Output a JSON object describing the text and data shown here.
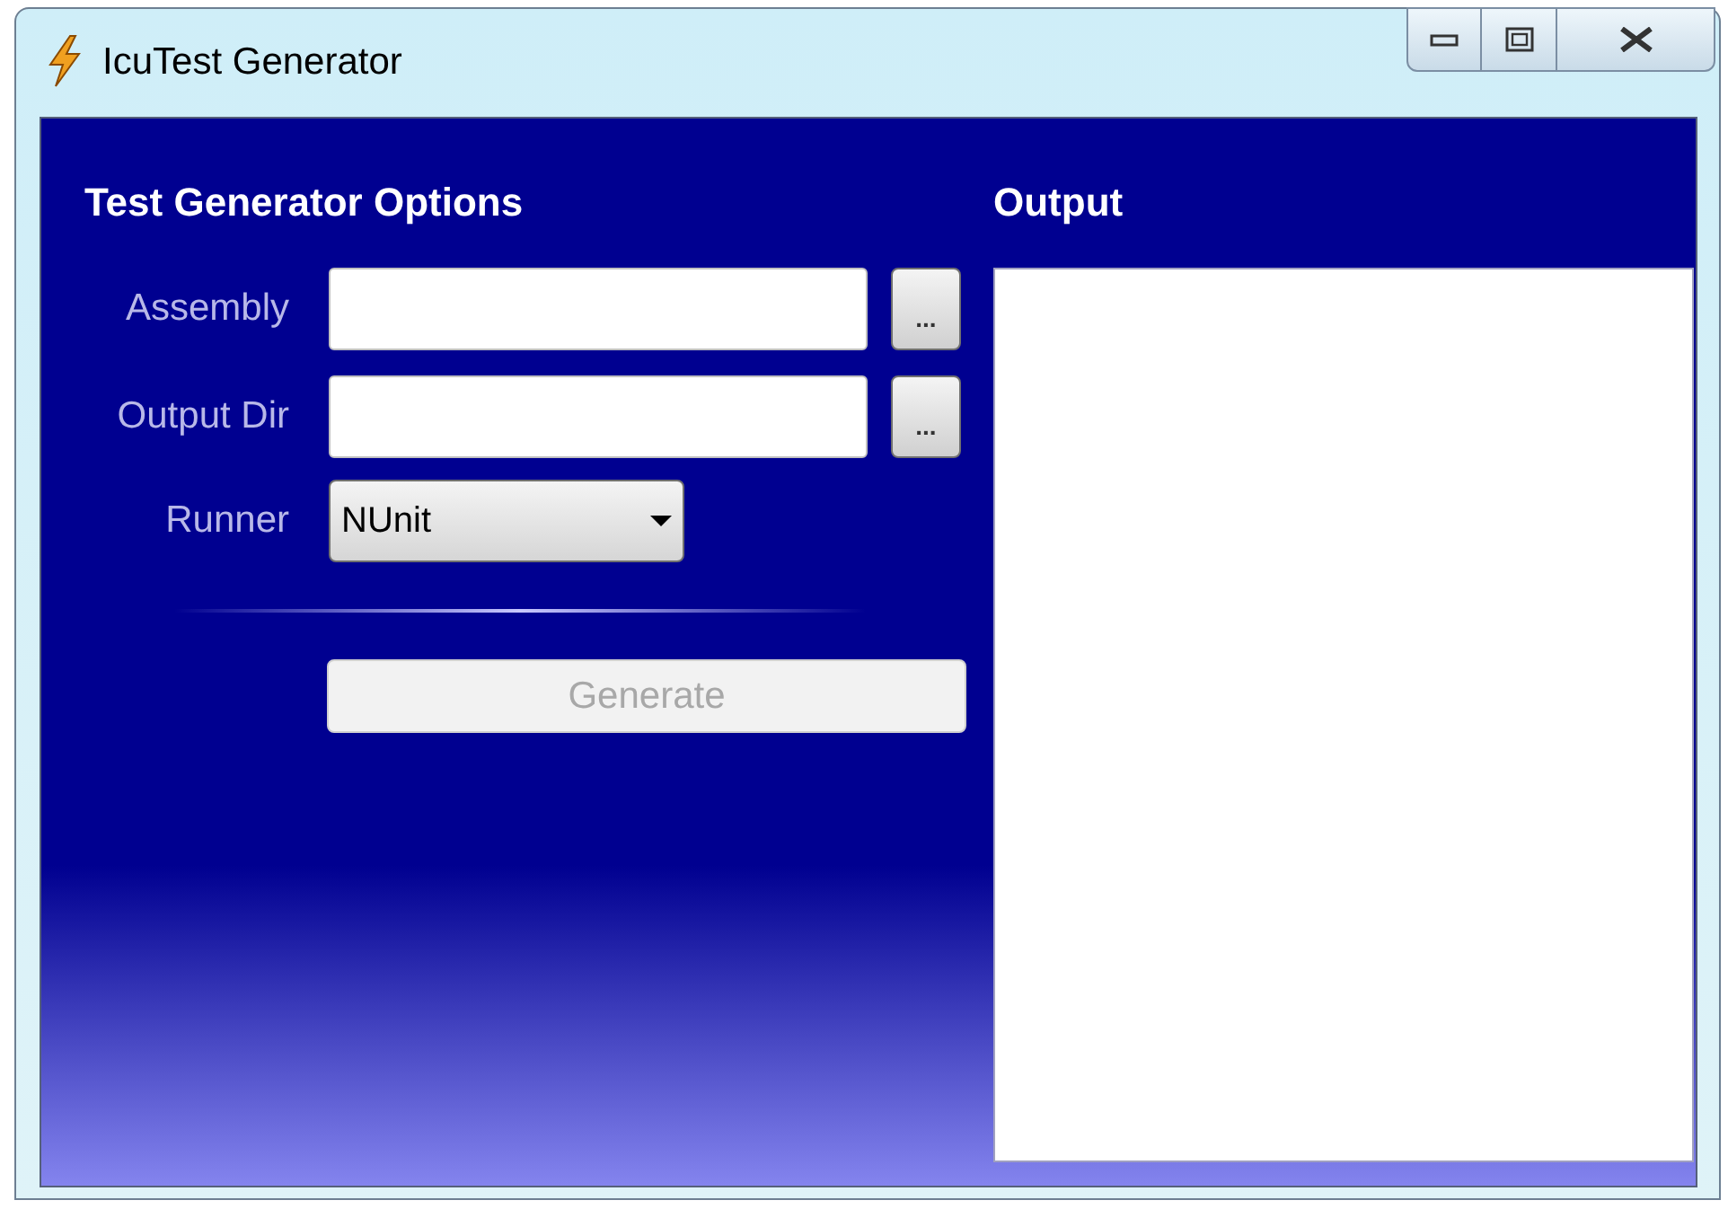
{
  "window": {
    "title": "IcuTest Generator"
  },
  "options": {
    "heading": "Test Generator Options",
    "fields": [
      {
        "label": "Assembly",
        "browse": "..."
      },
      {
        "label": "Output Dir",
        "browse": "..."
      }
    ],
    "runner": {
      "label": "Runner",
      "value": "NUnit"
    },
    "generate": {
      "label": "Generate",
      "disabled": true
    }
  },
  "output": {
    "heading": "Output"
  }
}
